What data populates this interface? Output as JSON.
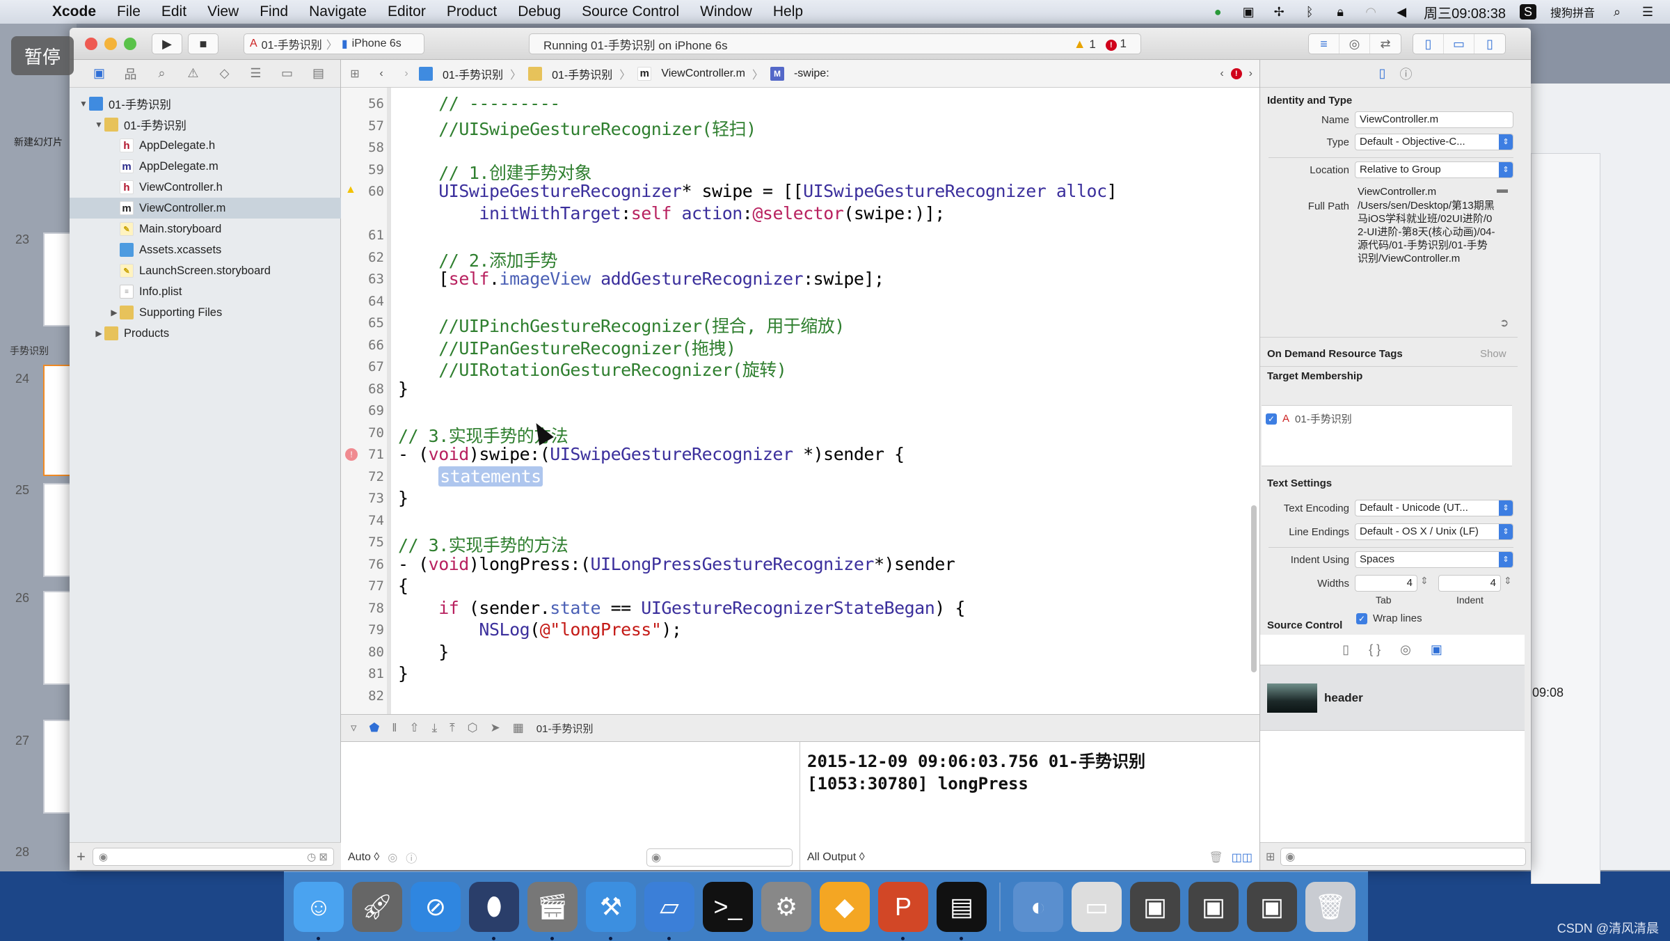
{
  "menubar": {
    "app": "Xcode",
    "items": [
      "File",
      "Edit",
      "View",
      "Find",
      "Navigate",
      "Editor",
      "Product",
      "Debug",
      "Source Control",
      "Window",
      "Help"
    ],
    "clock": "周三09:08:38",
    "input_method": "搜狗拼音"
  },
  "overlay": {
    "pause_label": "暂停"
  },
  "keynote": {
    "new_slide_label": "新建幻灯片",
    "section_label": "手势识别",
    "slide_numbers": [
      "23",
      "24",
      "25",
      "26",
      "27",
      "28"
    ],
    "right_time": "09:08"
  },
  "toolbar": {
    "scheme_target": "01-手势识别",
    "scheme_device": "iPhone 6s",
    "activity_text": "Running 01-手势识别 on iPhone 6s",
    "warning_count": "1",
    "error_count": "1"
  },
  "jumpbar": {
    "items": [
      "01-手势识别",
      "01-手势识别",
      "ViewController.m",
      "-swipe:"
    ]
  },
  "navigator": {
    "tree": [
      {
        "label": "01-手势识别",
        "icon": "project",
        "depth": 0,
        "disclosure": "open"
      },
      {
        "label": "01-手势识别",
        "icon": "folder",
        "depth": 1,
        "disclosure": "open"
      },
      {
        "label": "AppDelegate.h",
        "icon": "h",
        "depth": 2
      },
      {
        "label": "AppDelegate.m",
        "icon": "m",
        "depth": 2
      },
      {
        "label": "ViewController.h",
        "icon": "h",
        "depth": 2
      },
      {
        "label": "ViewController.m",
        "icon": "m",
        "depth": 2,
        "selected": true
      },
      {
        "label": "Main.storyboard",
        "icon": "storyboard",
        "depth": 2
      },
      {
        "label": "Assets.xcassets",
        "icon": "assets",
        "depth": 2
      },
      {
        "label": "LaunchScreen.storyboard",
        "icon": "storyboard",
        "depth": 2
      },
      {
        "label": "Info.plist",
        "icon": "plist",
        "depth": 2
      },
      {
        "label": "Supporting Files",
        "icon": "folder",
        "depth": 2,
        "disclosure": "closed"
      },
      {
        "label": "Products",
        "icon": "folder",
        "depth": 1,
        "disclosure": "closed"
      }
    ]
  },
  "editor": {
    "lines": [
      {
        "n": "56",
        "html": "    <span class='cm'>// ---------</span>"
      },
      {
        "n": "57",
        "html": "    <span class='cm'>//UISwipeGestureRecognizer(轻扫)</span>"
      },
      {
        "n": "58",
        "html": ""
      },
      {
        "n": "59",
        "html": "    <span class='cm'>// 1.创建手势对象</span>"
      },
      {
        "n": "60",
        "html": "    <span class='ty'>UISwipeGestureRecognizer</span>* swipe = [[<span class='ty'>UISwipeGestureRecognizer</span> <span class='ty'>alloc</span>]",
        "marker": "warning"
      },
      {
        "n": "",
        "html": "        <span class='ty'>initWithTarget</span>:<span class='kw'>self</span> <span class='ty'>action</span>:<span class='kw'>@selector</span>(swipe:)];"
      },
      {
        "n": "61",
        "html": ""
      },
      {
        "n": "62",
        "html": "    <span class='cm'>// 2.添加手势</span>"
      },
      {
        "n": "63",
        "html": "    [<span class='kw'>self</span>.<span class='pr'>imageView</span> <span class='ty'>addGestureRecognizer</span>:swipe];"
      },
      {
        "n": "64",
        "html": ""
      },
      {
        "n": "65",
        "html": "    <span class='cm'>//UIPinchGestureRecognizer(捏合, 用于缩放)</span>"
      },
      {
        "n": "66",
        "html": "    <span class='cm'>//UIPanGestureRecognizer(拖拽)</span>"
      },
      {
        "n": "67",
        "html": "    <span class='cm'>//UIRotationGestureRecognizer(旋转)</span>"
      },
      {
        "n": "68",
        "html": "}"
      },
      {
        "n": "69",
        "html": ""
      },
      {
        "n": "70",
        "html": "<span class='cm'>// 3.实现手势的方法</span>"
      },
      {
        "n": "71",
        "html": "- (<span class='kw'>void</span>)swipe:(<span class='ty'>UISwipeGestureRecognizer</span> *)sender {",
        "marker": "error"
      },
      {
        "n": "72",
        "html": "    <span class='ph'>statements</span>"
      },
      {
        "n": "73",
        "html": "}"
      },
      {
        "n": "74",
        "html": ""
      },
      {
        "n": "75",
        "html": "<span class='cm'>// 3.实现手势的方法</span>"
      },
      {
        "n": "76",
        "html": "- (<span class='kw'>void</span>)longPress:(<span class='ty'>UILongPressGestureRecognizer</span>*)sender"
      },
      {
        "n": "77",
        "html": "{"
      },
      {
        "n": "78",
        "html": "    <span class='kw'>if</span> (sender.<span class='pr'>state</span> == <span class='ty'>UIGestureRecognizerStateBegan</span>) {"
      },
      {
        "n": "79",
        "html": "        <span class='ty'>NSLog</span>(<span class='st'>@\"longPress\"</span>);"
      },
      {
        "n": "80",
        "html": "    }"
      },
      {
        "n": "81",
        "html": "}"
      },
      {
        "n": "82",
        "html": ""
      }
    ]
  },
  "debug": {
    "process_label": "01-手势识别",
    "vars_mode": "Auto ◊",
    "console_filter": "All Output ◊",
    "console_lines": [
      "2015-12-09 09:06:03.756 01-手势识别",
      "[1053:30780] longPress"
    ]
  },
  "inspector": {
    "identity_title": "Identity and Type",
    "name_label": "Name",
    "name_value": "ViewController.m",
    "type_label": "Type",
    "type_value": "Default - Objective-C...",
    "location_label": "Location",
    "location_value": "Relative to Group",
    "location_file": "ViewController.m",
    "fullpath_label": "Full Path",
    "fullpath_value": "/Users/sen/Desktop/第13期黑马iOS学科就业班/02UI进阶/02-UI进阶-第8天(核心动画)/04-源代码/01-手势识别/01-手势识别/ViewController.m",
    "odr_title": "On Demand Resource Tags",
    "odr_show": "Show",
    "target_title": "Target Membership",
    "target_item": "01-手势识别",
    "target_checked": true,
    "text_title": "Text Settings",
    "encoding_label": "Text Encoding",
    "encoding_value": "Default - Unicode (UT...",
    "endings_label": "Line Endings",
    "endings_value": "Default - OS X / Unix (LF)",
    "indent_label": "Indent Using",
    "indent_value": "Spaces",
    "widths_label": "Widths",
    "tab_width": "4",
    "indent_width": "4",
    "tab_caption": "Tab",
    "indent_caption": "Indent",
    "wrap_label": "Wrap lines",
    "wrap_checked": true,
    "source_title": "Source Control",
    "library_item": "header"
  },
  "dock": {
    "apps": [
      "finder",
      "launchpad",
      "safari",
      "mouse-app",
      "movie-app",
      "xcode",
      "simulator",
      "terminal",
      "system-preferences",
      "sketch",
      "powerpoint",
      "console",
      "keynote-doc",
      "preview-doc",
      "screen1",
      "screen2",
      "screen3",
      "trash"
    ]
  },
  "watermark": "CSDN @清风清晨"
}
